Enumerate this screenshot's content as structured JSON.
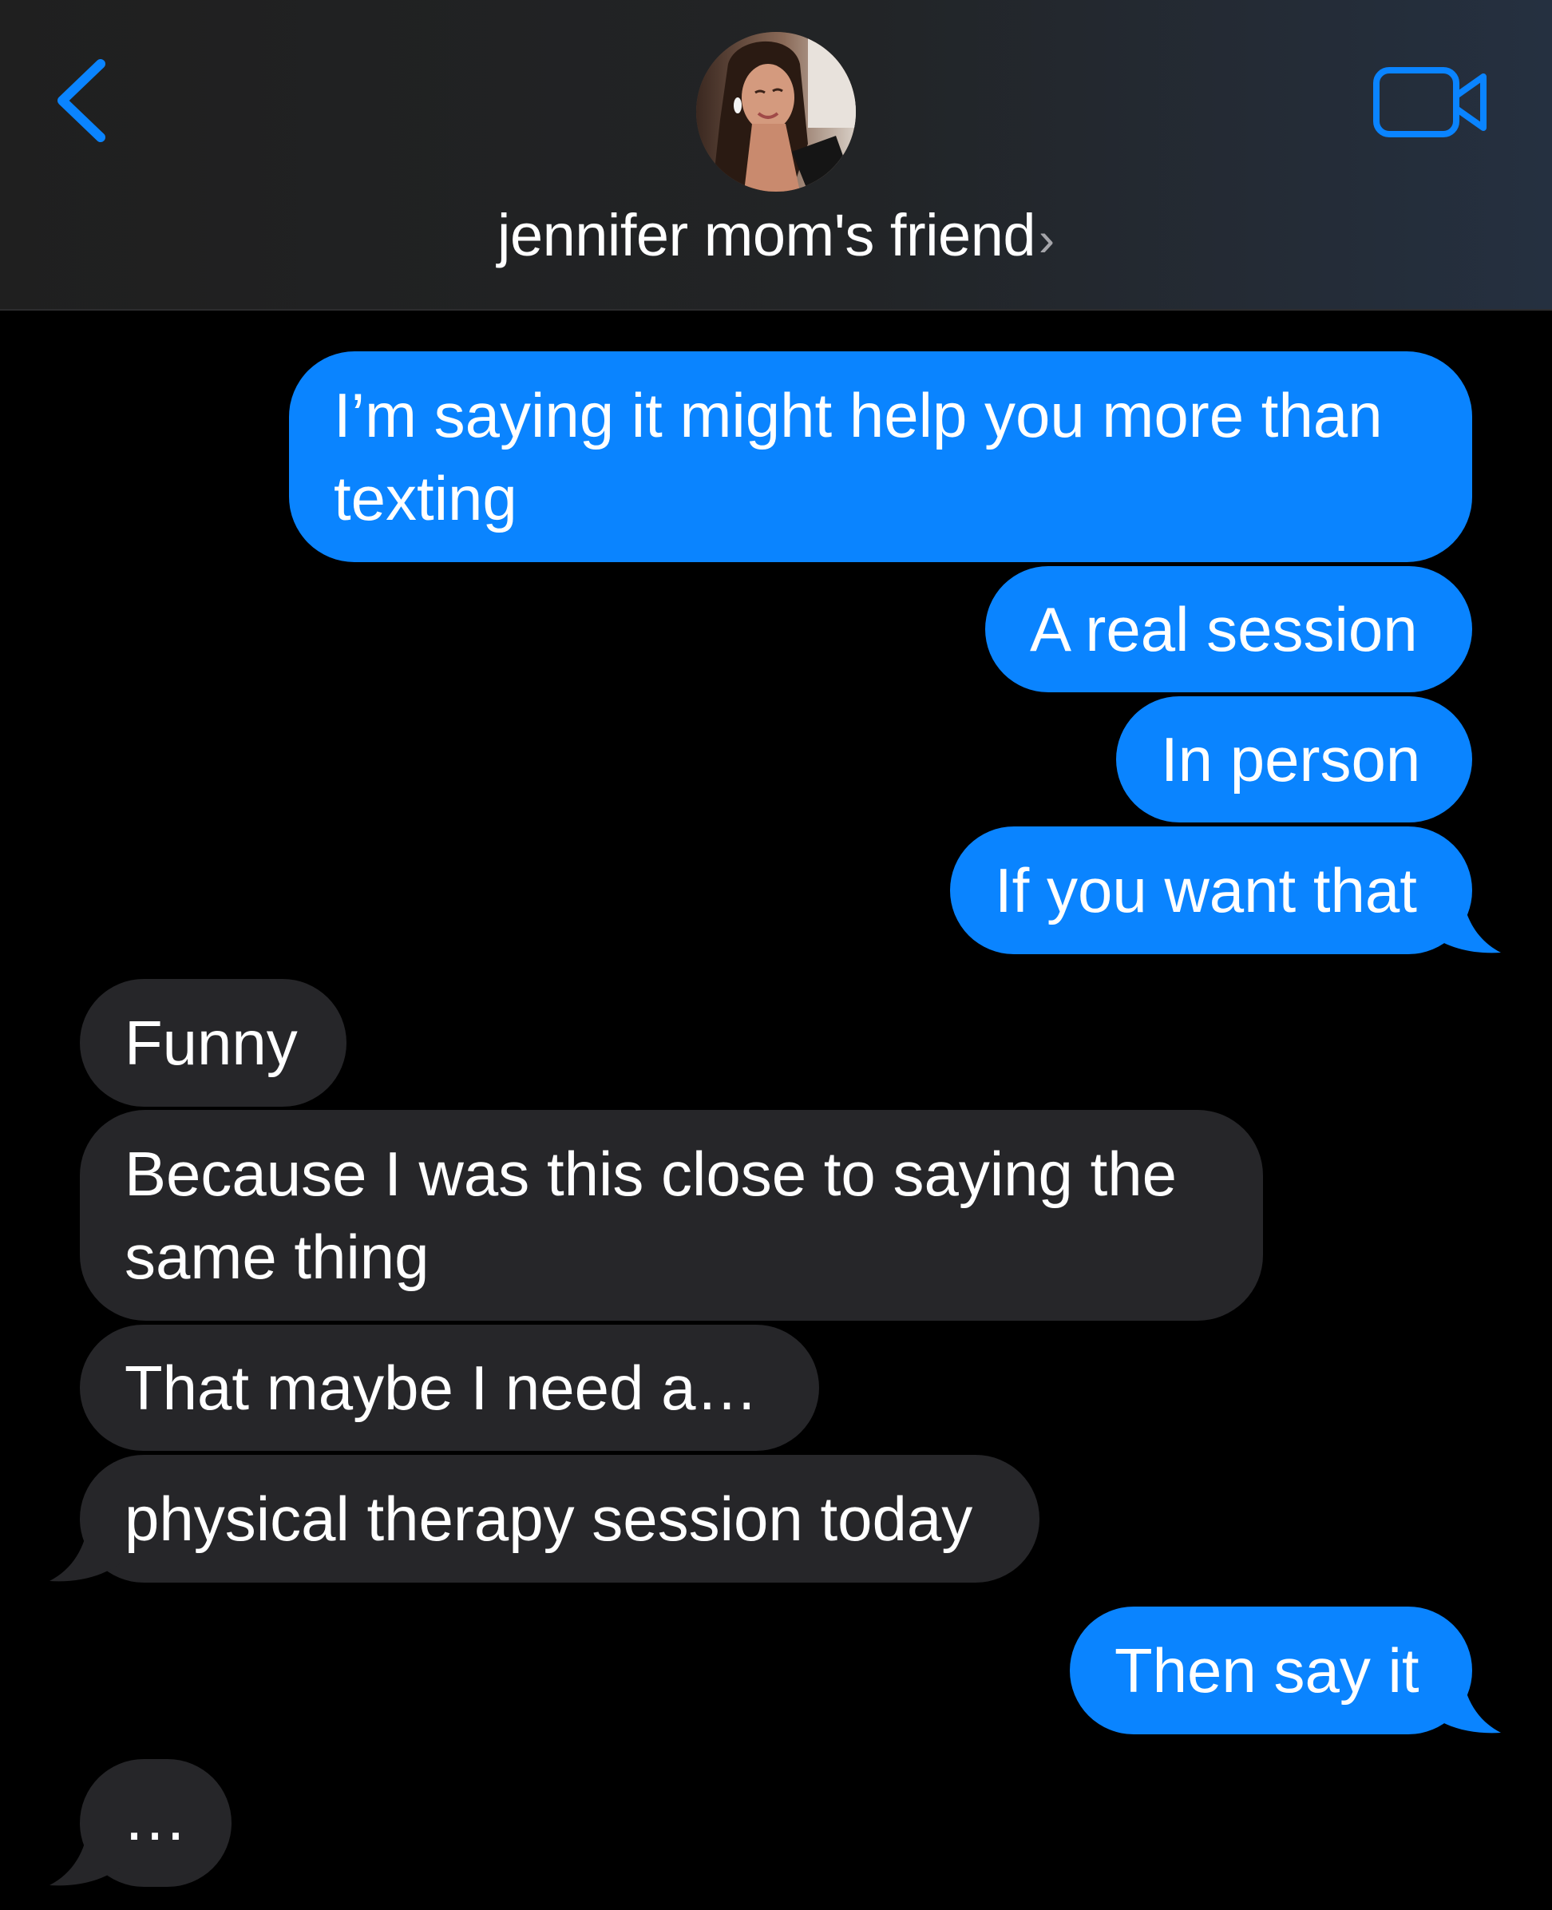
{
  "colors": {
    "outgoing_bubble": "#0a84ff",
    "incoming_bubble": "#262629",
    "accent": "#0a84ff",
    "background": "#000000",
    "header_background": "#1f1f1f"
  },
  "header": {
    "back_icon": "chevron-left-icon",
    "contact_name": "jennifer mom's friend",
    "name_chevron": "›",
    "video_icon": "video-camera-icon",
    "avatar_icon": "contact-photo"
  },
  "messages": [
    {
      "direction": "outgoing",
      "lines": [
        "I’m saying it might help you more than",
        "texting"
      ]
    },
    {
      "direction": "outgoing",
      "text": "A real session"
    },
    {
      "direction": "outgoing",
      "text": "In person"
    },
    {
      "direction": "outgoing",
      "text": "If you want that"
    },
    {
      "direction": "incoming",
      "text": "Funny"
    },
    {
      "direction": "incoming",
      "lines": [
        "Because I was this close to saying the",
        "same thing"
      ]
    },
    {
      "direction": "incoming",
      "text": "That maybe I need a…"
    },
    {
      "direction": "incoming",
      "text": "physical therapy session today"
    },
    {
      "direction": "outgoing",
      "text": "Then say it"
    },
    {
      "direction": "incoming",
      "typing": true,
      "text": "…"
    }
  ]
}
